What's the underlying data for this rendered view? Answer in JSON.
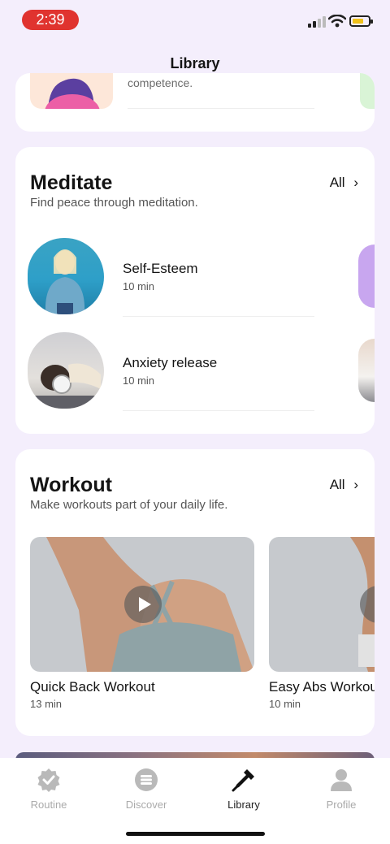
{
  "status_bar": {
    "time": "2:39"
  },
  "nav": {
    "title": "Library"
  },
  "top_card": {
    "peek_text": "competence."
  },
  "meditate": {
    "title": "Meditate",
    "subtitle": "Find peace through meditation.",
    "all_label": "All",
    "items": [
      {
        "title": "Self-Esteem",
        "duration": "10 min"
      },
      {
        "title": "Anxiety release",
        "duration": "10 min"
      }
    ]
  },
  "workout": {
    "title": "Workout",
    "subtitle": "Make workouts part of your daily life.",
    "all_label": "All",
    "items": [
      {
        "title": "Quick Back Workout",
        "duration": "13 min"
      },
      {
        "title": "Easy Abs Workout",
        "duration": "10 min"
      }
    ]
  },
  "tabs": [
    {
      "label": "Routine",
      "icon": "badge-check-icon",
      "active": false
    },
    {
      "label": "Discover",
      "icon": "list-circle-icon",
      "active": false
    },
    {
      "label": "Library",
      "icon": "dropper-icon",
      "active": true
    },
    {
      "label": "Profile",
      "icon": "person-icon",
      "active": false
    }
  ],
  "colors": {
    "accent_time": "#e0332f",
    "background": "#f4eefc",
    "battery": "#f0c21a"
  }
}
